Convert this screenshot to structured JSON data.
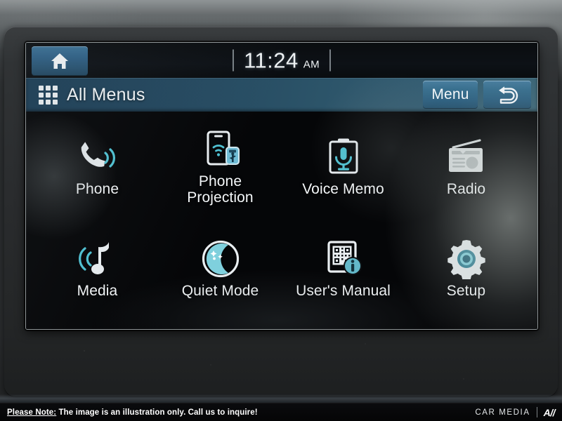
{
  "statusbar": {
    "home_icon": "home-icon",
    "clock_time": "11:24",
    "clock_ampm": "AM"
  },
  "titlebar": {
    "grid_icon": "grid-menu-icon",
    "title": "All Menus",
    "menu_label": "Menu",
    "back_icon": "back-arrow-icon"
  },
  "apps": [
    {
      "label": "Phone",
      "icon": "phone-handset-icon"
    },
    {
      "label": "Phone\nProjection",
      "icon": "phone-projection-icon"
    },
    {
      "label": "Voice Memo",
      "icon": "voice-memo-microphone-icon"
    },
    {
      "label": "Radio",
      "icon": "radio-icon"
    },
    {
      "label": "Media",
      "icon": "music-note-icon"
    },
    {
      "label": "Quiet Mode",
      "icon": "moon-quiet-mode-icon"
    },
    {
      "label": "User's Manual",
      "icon": "qr-manual-info-icon"
    },
    {
      "label": "Setup",
      "icon": "gear-setup-icon"
    }
  ],
  "footer": {
    "note_prefix": "Please Note:",
    "note_text": " The image is an illustration only. Call us to inquire!",
    "brand_text": "CAR MEDIA",
    "brand_mark": "A//"
  },
  "colors": {
    "accent_blue": "#2f6187",
    "title_blue": "#2c5469",
    "icon_cyan": "#4fc3d4",
    "icon_white": "#e9eef1",
    "screen_black": "#050608"
  }
}
